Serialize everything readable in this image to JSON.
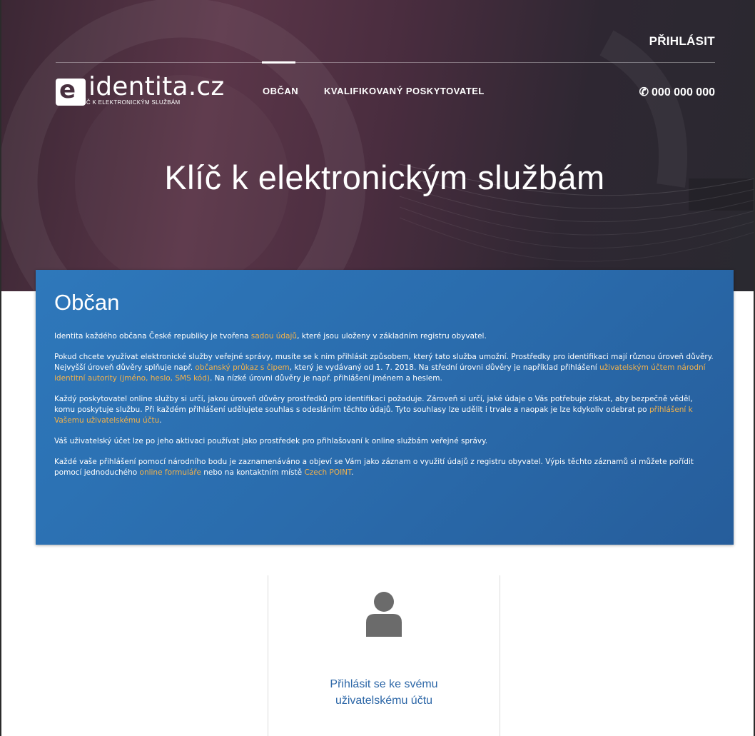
{
  "header": {
    "login_label": "PŘIHLÁSIT",
    "logo": {
      "mark": "e",
      "wordmark": "identita.cz",
      "tagline": "KLÍČ K ELEKTRONICKÝM SLUŽBÁM"
    },
    "nav": [
      {
        "label": "OBČAN",
        "active": true
      },
      {
        "label": "KVALIFIKOVANÝ POSKYTOVATEL",
        "active": false
      }
    ],
    "phone": {
      "icon": "phone-icon",
      "number": "000 000 000"
    }
  },
  "hero": {
    "title": "Klíč k elektronickým službám"
  },
  "citizen": {
    "title": "Občan",
    "p1": {
      "t1": "Identita každého občana České republiky je tvořena ",
      "link": "sadou údajů",
      "t2": ", které jsou uloženy v základním registru obyvatel."
    },
    "p2": {
      "t1": "Pokud chcete využívat elektronické služby veřejné správy, musíte se k nim přihlásit způsobem, který tato služba umožní. Prostředky pro identifikaci mají různou úroveň důvěry. Nejvyšší úroveň důvěry splňuje např. ",
      "link1": "občanský průkaz s čipem",
      "t2": ", který je vydávaný od 1. 7. 2018. Na střední úrovni důvěry je například přihlášení ",
      "link2": "uživatelským účtem národní identitní autority (jméno, heslo, SMS kód)",
      "t3": ". Na nízké úrovni důvěry je např. přihlášení jménem a heslem."
    },
    "p3": {
      "t1": "Každý poskytovatel online služby si určí, jakou úroveň důvěry prostředků pro identifikaci požaduje. Zároveň si určí, jaké údaje o Vás potřebuje získat, aby bezpečně věděl, komu poskytuje službu. Při každém přihlášení udělujete souhlas s odesláním těchto údajů. Tyto souhlasy lze udělit i trvale a naopak je lze kdykoliv odebrat po ",
      "link": "přihlášení k Vašemu uživatelskému účtu",
      "t2": "."
    },
    "p4": {
      "t1": "Váš uživatelský účet lze po jeho aktivaci používat jako prostředek pro přihlašovaní k online službám veřejné správy."
    },
    "p5": {
      "t1": "Každé vaše přihlášení pomocí národního bodu je zaznamenáváno a objeví se Vám jako záznam o využití údajů z registru obyvatel. Výpis těchto záznamů si můžete pořídit pomocí jednoduchého ",
      "link1": "online formuláře",
      "t2": " nebo na kontaktním místě ",
      "link2": "Czech POINT",
      "t3": "."
    }
  },
  "account": {
    "icon": "user-icon",
    "line1": "Přihlásit se ke svému",
    "line2": "uživatelskému účtu"
  },
  "colors": {
    "card_blue": "#2a6cad",
    "link_orange": "#f3b24b",
    "account_link_blue": "#2d67a7",
    "icon_gray": "#6b6b6b"
  }
}
